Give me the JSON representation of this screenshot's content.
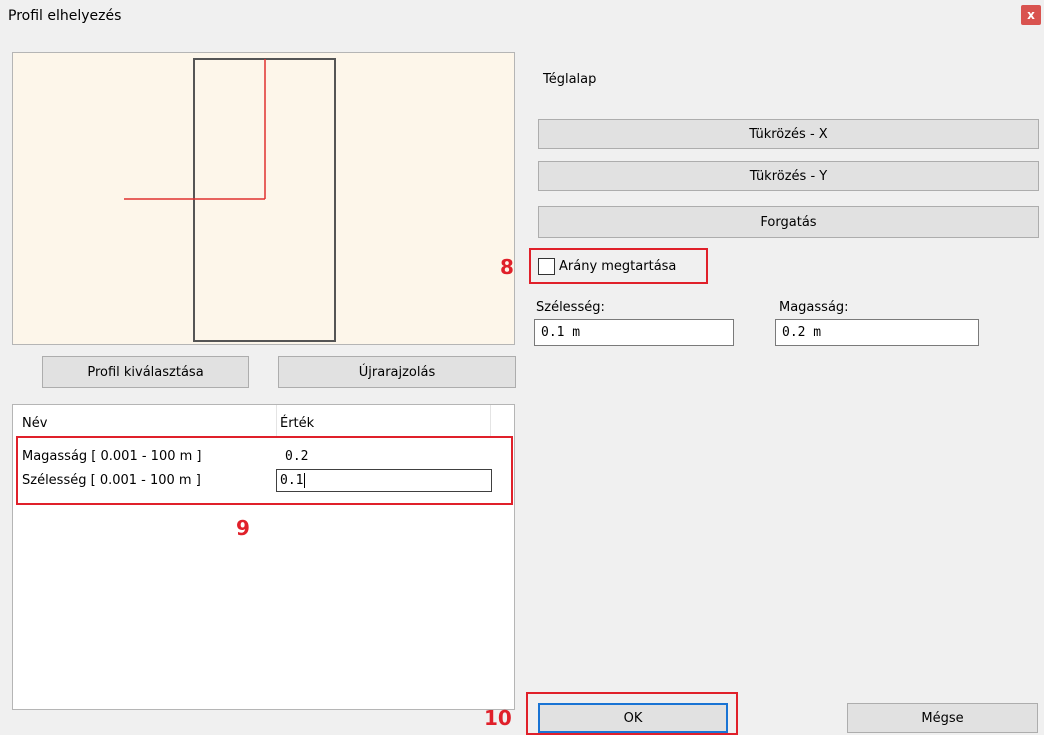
{
  "window": {
    "title": "Profil elhelyezés",
    "close_label": "x"
  },
  "left": {
    "select_profile_label": "Profil kiválasztása",
    "redraw_label": "Újrarajzolás",
    "table": {
      "headers": [
        "Név",
        "Érték"
      ],
      "rows": [
        {
          "name": "Magasság [ 0.001 - 100 m ]",
          "value": "0.2"
        },
        {
          "name": "Szélesség [ 0.001 - 100 m ]",
          "value": "0.1"
        }
      ]
    }
  },
  "right": {
    "shape_label": "Téglalap",
    "mirror_x_label": "Tükrözés - X",
    "mirror_y_label": "Tükrözés - Y",
    "rotate_label": "Forgatás",
    "keep_ratio_label": "Arány megtartása",
    "keep_ratio_checked": false,
    "width_label": "Szélesség:",
    "width_value": "0.1 m",
    "height_label": "Magasság:",
    "height_value": "0.2 m"
  },
  "footer": {
    "ok_label": "OK",
    "cancel_label": "Mégse"
  },
  "annotations": {
    "marker_8": "8",
    "marker_9": "9",
    "marker_10": "10"
  },
  "colors": {
    "highlight": "#e0202a",
    "focus": "#1a74d4",
    "preview_bg": "#fdf6ea"
  }
}
